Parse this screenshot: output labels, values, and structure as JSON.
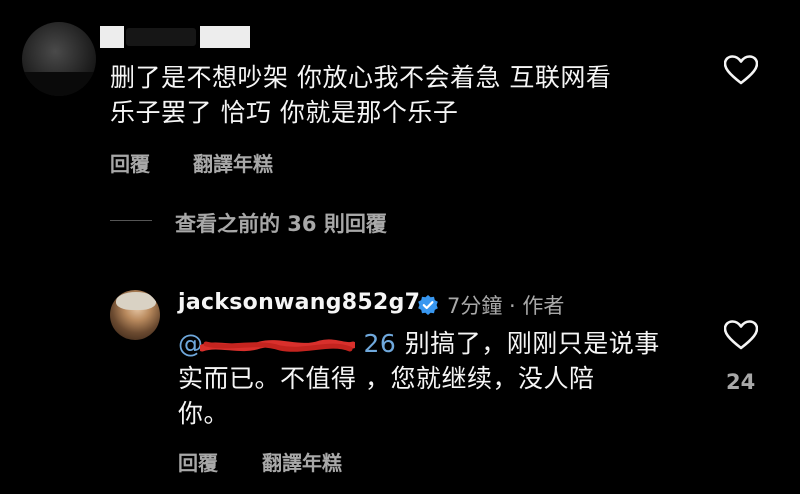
{
  "top_comment": {
    "text_line1": "删了是不想吵架 你放心我不会着急 互联网看",
    "text_line2": "乐子罢了 恰巧 你就是那个乐子",
    "reply_label": "回覆",
    "translate_label": "翻譯年糕"
  },
  "thread": {
    "view_previous_label": "查看之前的 36 則回覆"
  },
  "author_reply": {
    "username": "jacksonwang852g7",
    "time_meta": "7分鐘 · 作者",
    "mention_prefix": "@",
    "mention_suffix": "26",
    "text_line1": "别搞了，刚刚只是说事",
    "text_line2": "实而已。不值得 ，您就继续，没人陪",
    "text_line3": "你。",
    "like_count": "24",
    "reply_label": "回覆",
    "translate_label": "翻譯年糕"
  },
  "colors": {
    "background": "#000000",
    "text_primary": "#f5f5f5",
    "text_secondary": "#a8a8a8",
    "verified_blue": "#3897f0",
    "redaction_red": "#d9302c"
  },
  "icons": {
    "like": "heart-outline-icon",
    "verified": "verified-badge-icon"
  }
}
